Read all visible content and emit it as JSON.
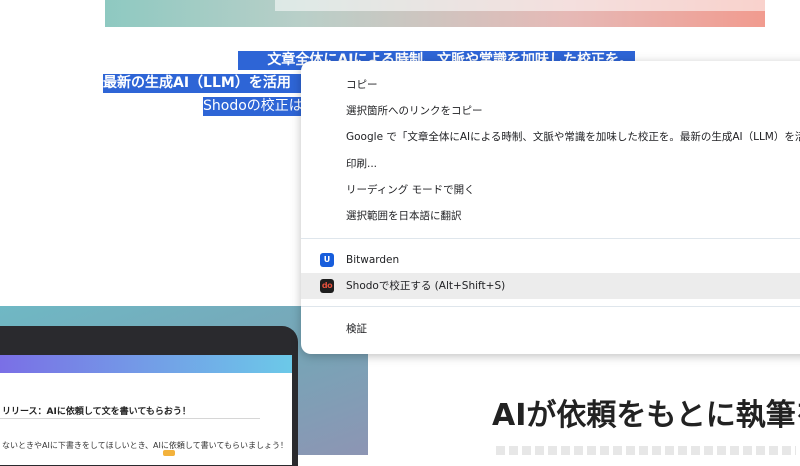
{
  "article": {
    "selected_lines": [
      "文章全体にAIによる時制、文脈や常識を加味した校正を。",
      "最新の生成AI（LLM）を活用",
      "Shodoの校正は"
    ],
    "illustration": {
      "title": "リリース：AIに依頼して文を書いてもらおう！",
      "text": "ないときやAIに下書きをしてほしいとき、AIに依頼して書いてもらいましょう！"
    },
    "heading": "AIが依頼をもとに執筆を"
  },
  "context_menu": {
    "items": [
      "コピー",
      "選択箇所へのリンクをコピー",
      "Google で「文章全体にAIによる時制、文脈や常識を加味した校正を。最新の生成AI（LLM）を活用",
      "印刷...",
      "リーディング モードで開く",
      "選択範囲を日本語に翻訳"
    ],
    "extensions": [
      {
        "label": "Bitwarden",
        "icon": "bitwarden-icon",
        "glyph": "U",
        "color": "#175ddc"
      },
      {
        "label": "Shodoで校正する (Alt+Shift+S)",
        "icon": "shodo-icon",
        "glyph": "do",
        "color": "#1e1e1e"
      }
    ],
    "inspect": "検証"
  }
}
